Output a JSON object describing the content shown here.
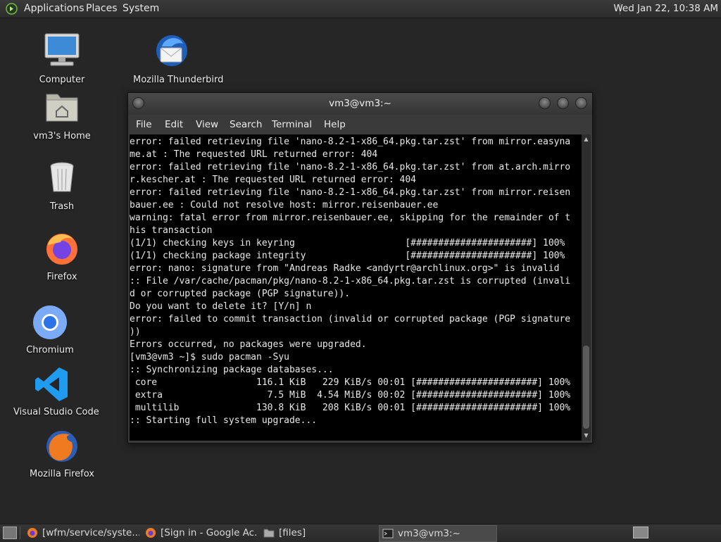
{
  "top_panel": {
    "applications": "Applications",
    "places": "Places",
    "system": "System",
    "clock": "Wed Jan 22, 10:38 AM"
  },
  "desktop_icons": [
    {
      "label": "Computer",
      "icon": "computer-icon"
    },
    {
      "label": "vm3's Home",
      "icon": "home-folder-icon"
    },
    {
      "label": "Trash",
      "icon": "trash-icon"
    },
    {
      "label": "Firefox",
      "icon": "firefox-icon"
    },
    {
      "label": "Chromium",
      "icon": "chromium-icon"
    },
    {
      "label": "Visual Studio Code",
      "icon": "vscode-icon"
    },
    {
      "label": "Mozilla Firefox",
      "icon": "mozilla-firefox-icon"
    },
    {
      "label": "Mozilla Thunderbird",
      "icon": "thunderbird-icon"
    }
  ],
  "terminal": {
    "title": "vm3@vm3:~",
    "menu": [
      "File",
      "Edit",
      "View",
      "Search",
      "Terminal",
      "Help"
    ],
    "lines": [
      "error: failed retrieving file 'nano-8.2-1-x86_64.pkg.tar.zst' from mirror.easyna",
      "me.at : The requested URL returned error: 404",
      "error: failed retrieving file 'nano-8.2-1-x86_64.pkg.tar.zst' from at.arch.mirro",
      "r.kescher.at : The requested URL returned error: 404",
      "error: failed retrieving file 'nano-8.2-1-x86_64.pkg.tar.zst' from mirror.reisen",
      "bauer.ee : Could not resolve host: mirror.reisenbauer.ee",
      "warning: fatal error from mirror.reisenbauer.ee, skipping for the remainder of t",
      "his transaction",
      "(1/1) checking keys in keyring                    [######################] 100%",
      "(1/1) checking package integrity                  [######################] 100%",
      "error: nano: signature from \"Andreas Radke <andyrtr@archlinux.org>\" is invalid",
      ":: File /var/cache/pacman/pkg/nano-8.2-1-x86_64.pkg.tar.zst is corrupted (invali",
      "d or corrupted package (PGP signature)).",
      "Do you want to delete it? [Y/n] n",
      "error: failed to commit transaction (invalid or corrupted package (PGP signature",
      "))",
      "Errors occurred, no packages were upgraded.",
      "[vm3@vm3 ~]$ sudo pacman -Syu",
      ":: Synchronizing package databases...",
      " core                  116.1 KiB   229 KiB/s 00:01 [######################] 100%",
      " extra                   7.5 MiB  4.54 MiB/s 00:02 [######################] 100%",
      " multilib              130.8 KiB   208 KiB/s 00:01 [######################] 100%",
      ":: Starting full system upgrade..."
    ]
  },
  "taskbar": [
    {
      "label": "[wfm/service/syste...",
      "icon": "firefox-icon",
      "active": false
    },
    {
      "label": "[Sign in - Google Ac...",
      "icon": "firefox-icon",
      "active": false
    },
    {
      "label": "[files]",
      "icon": "folder-icon",
      "active": false
    },
    {
      "label": "vm3@vm3:~",
      "icon": "terminal-icon",
      "active": true
    }
  ]
}
